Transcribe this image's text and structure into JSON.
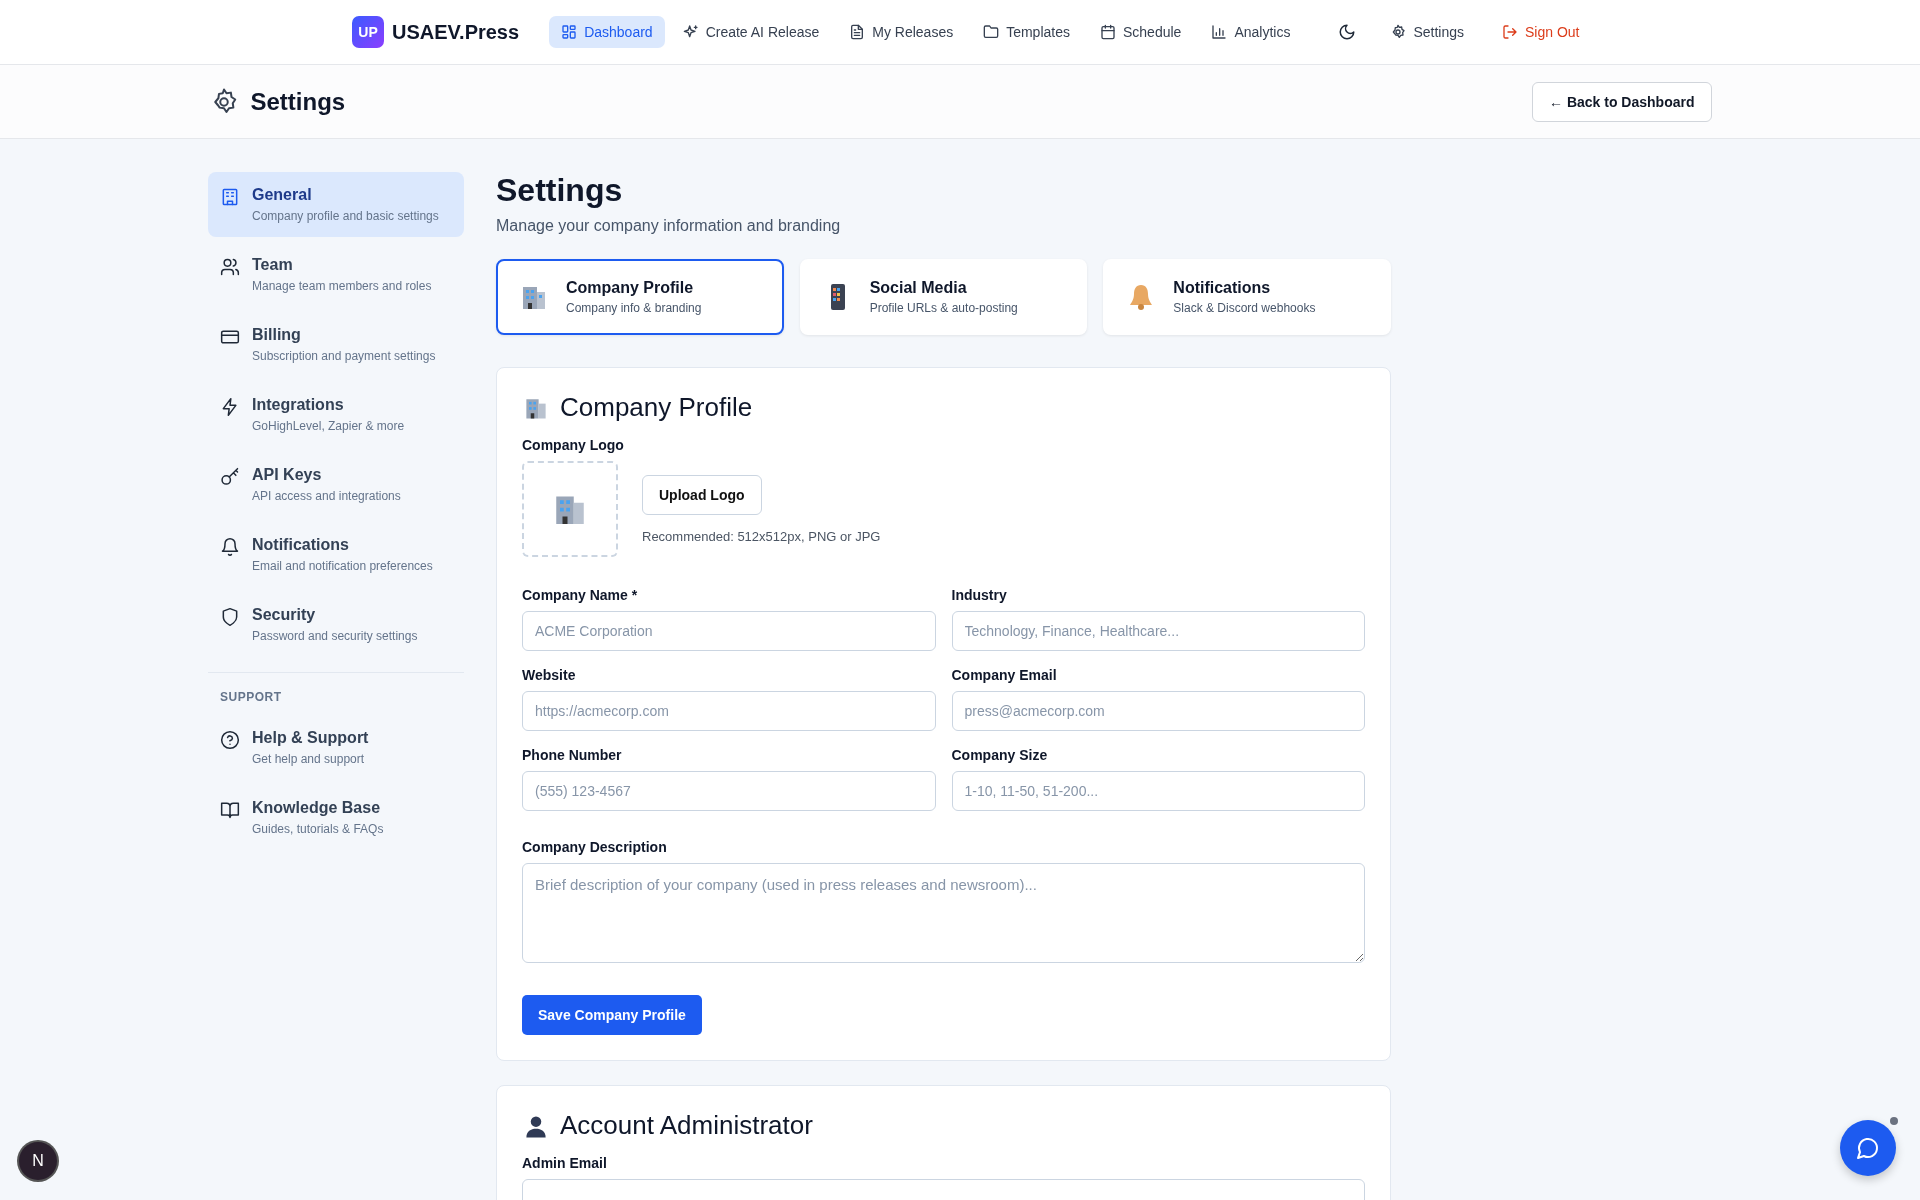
{
  "nav": {
    "logo_badge": "UP",
    "brand": "USAEV.Press",
    "items": [
      {
        "label": "Dashboard",
        "selected": true
      },
      {
        "label": "Create AI Release",
        "selected": false
      },
      {
        "label": "My Releases",
        "selected": false
      },
      {
        "label": "Templates",
        "selected": false
      },
      {
        "label": "Schedule",
        "selected": false
      },
      {
        "label": "Analytics",
        "selected": false
      }
    ],
    "actions": [
      {
        "kind": "theme"
      },
      {
        "kind": "link",
        "label": "Settings"
      },
      {
        "kind": "danger",
        "label": "Sign Out"
      }
    ]
  },
  "header": {
    "title": "Settings",
    "back_button": "← Back to Dashboard"
  },
  "sidebar": {
    "items": [
      {
        "label": "General",
        "description": "Company profile and basic settings",
        "selected": true
      },
      {
        "label": "Team",
        "description": "Manage team members and roles",
        "selected": false
      },
      {
        "label": "Billing",
        "description": "Subscription and payment settings",
        "selected": false
      },
      {
        "label": "Integrations",
        "description": "GoHighLevel, Zapier & more",
        "selected": false
      },
      {
        "label": "API Keys",
        "description": "API access and integrations",
        "selected": false
      },
      {
        "label": "Notifications",
        "description": "Email and notification preferences",
        "selected": false
      },
      {
        "label": "Security",
        "description": "Password and security settings",
        "selected": false
      }
    ],
    "support_heading": "SUPPORT",
    "support_items": [
      {
        "label": "Help & Support",
        "description": "Get help and support",
        "selected": false
      },
      {
        "label": "Knowledge Base",
        "description": "Guides, tutorials & FAQs",
        "selected": false
      }
    ]
  },
  "main": {
    "title": "Settings",
    "subtitle": "Manage your company information and branding",
    "tabs": [
      {
        "label": "Company Profile",
        "description": "Company info & branding",
        "selected": true
      },
      {
        "label": "Social Media",
        "description": "Profile URLs & auto-posting",
        "selected": false
      },
      {
        "label": "Notifications",
        "description": "Slack & Discord webhooks",
        "selected": false
      }
    ],
    "company_profile": {
      "title": "Company Profile",
      "logo_label": "Company Logo",
      "upload_button": "Upload Logo",
      "logo_hint": "Recommended: 512x512px, PNG or JPG",
      "fields": [
        {
          "kind": "text",
          "label": "Company Name *",
          "placeholder": "ACME Corporation"
        },
        {
          "kind": "text",
          "label": "Industry",
          "placeholder": "Technology, Finance, Healthcare..."
        },
        {
          "kind": "text",
          "label": "Website",
          "placeholder": "https://acmecorp.com"
        },
        {
          "kind": "text",
          "label": "Company Email",
          "placeholder": "press@acmecorp.com"
        },
        {
          "kind": "text",
          "label": "Phone Number",
          "placeholder": "(555) 123-4567"
        },
        {
          "kind": "text",
          "label": "Company Size",
          "placeholder": "1-10, 11-50, 51-200..."
        },
        {
          "kind": "textarea",
          "label": "Company Description",
          "placeholder": "Brief description of your company (used in press releases and newsroom)..."
        }
      ],
      "save_button": "Save Company Profile"
    },
    "account_admin": {
      "title": "Account Administrator",
      "fields": [
        {
          "label": "Admin Email"
        }
      ]
    }
  },
  "dev_badge": "N"
}
